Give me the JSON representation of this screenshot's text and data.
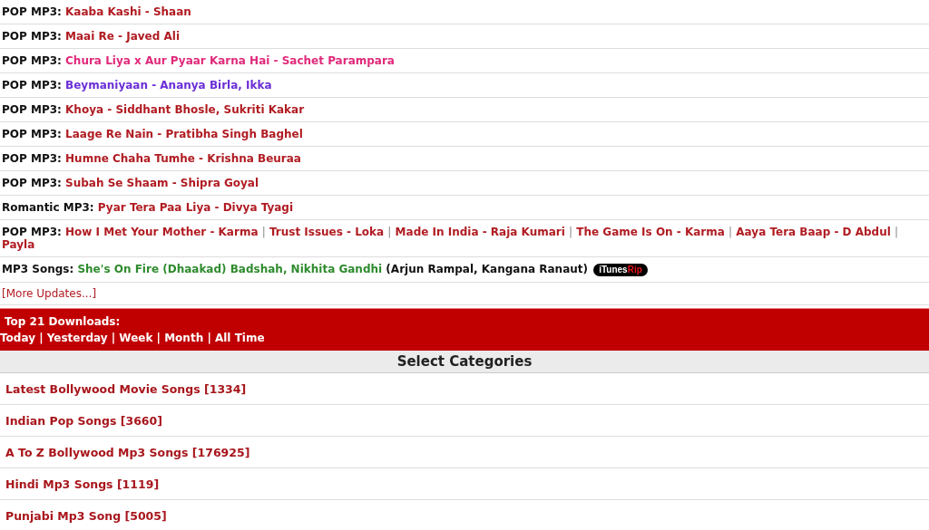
{
  "updates": [
    {
      "label": "POP MP3:",
      "color": "#b01c22",
      "lines": [
        [
          "Kaaba Kashi - Shaan"
        ]
      ]
    },
    {
      "label": "POP MP3:",
      "color": "#b01c22",
      "lines": [
        [
          "Maai Re - Javed Ali"
        ]
      ]
    },
    {
      "label": "POP MP3:",
      "color": "#e0297a",
      "lines": [
        [
          "Chura Liya x Aur Pyaar Karna Hai - Sachet Parampara"
        ]
      ]
    },
    {
      "label": "POP MP3:",
      "color": "#6a2ed6",
      "lines": [
        [
          "Beymaniyaan - Ananya Birla, Ikka"
        ]
      ]
    },
    {
      "label": "POP MP3:",
      "color": "#b01c22",
      "lines": [
        [
          "Khoya - Siddhant Bhosle, Sukriti Kakar"
        ]
      ]
    },
    {
      "label": "POP MP3:",
      "color": "#b01c22",
      "lines": [
        [
          "Laage Re Nain - Pratibha Singh Baghel"
        ]
      ]
    },
    {
      "label": "POP MP3:",
      "color": "#b01c22",
      "lines": [
        [
          "Humne Chaha Tumhe - Krishna Beuraa"
        ]
      ]
    },
    {
      "label": "POP MP3:",
      "color": "#b01c22",
      "lines": [
        [
          "Subah Se Shaam - Shipra Goyal"
        ]
      ]
    },
    {
      "label": "Romantic MP3:",
      "color": "#b01c22",
      "lines": [
        [
          "Pyar Tera Paa Liya - Divya Tyagi"
        ]
      ]
    },
    {
      "label": "POP MP3:",
      "color": "#b01c22",
      "separator": "|",
      "lines": [
        [
          "How I Met Your Mother - Karma",
          "Trust Issues - Loka",
          "Made In India - Raja Kumari",
          "The Game Is On - Karma",
          "Aaya Tera Baap - D Abdul"
        ],
        [
          "Payla"
        ]
      ]
    },
    {
      "label": "MP3 Songs:",
      "color": "#2e8b2e",
      "lines": [
        [
          "She's On Fire (Dhaakad) Badshah, Nikhita Gandhi"
        ]
      ],
      "note": "(Arjun Rampal, Kangana Ranaut)",
      "badge": [
        "iTunes",
        "Rip"
      ]
    }
  ],
  "more_link": "[More Updates...]",
  "top_downloads": {
    "title": "Top 21 Downloads:",
    "separator": "|",
    "periods": [
      "Today",
      "Yesterday",
      "Week",
      "Month",
      "All Time"
    ]
  },
  "categories": {
    "heading": "Select Categories",
    "items": [
      "Latest Bollywood Movie Songs [1334]",
      "Indian Pop Songs [3660]",
      "A To Z Bollywood Mp3 Songs [176925]",
      "Hindi Mp3 Songs [1119]",
      "Punjabi Mp3 Song [5005]"
    ]
  }
}
